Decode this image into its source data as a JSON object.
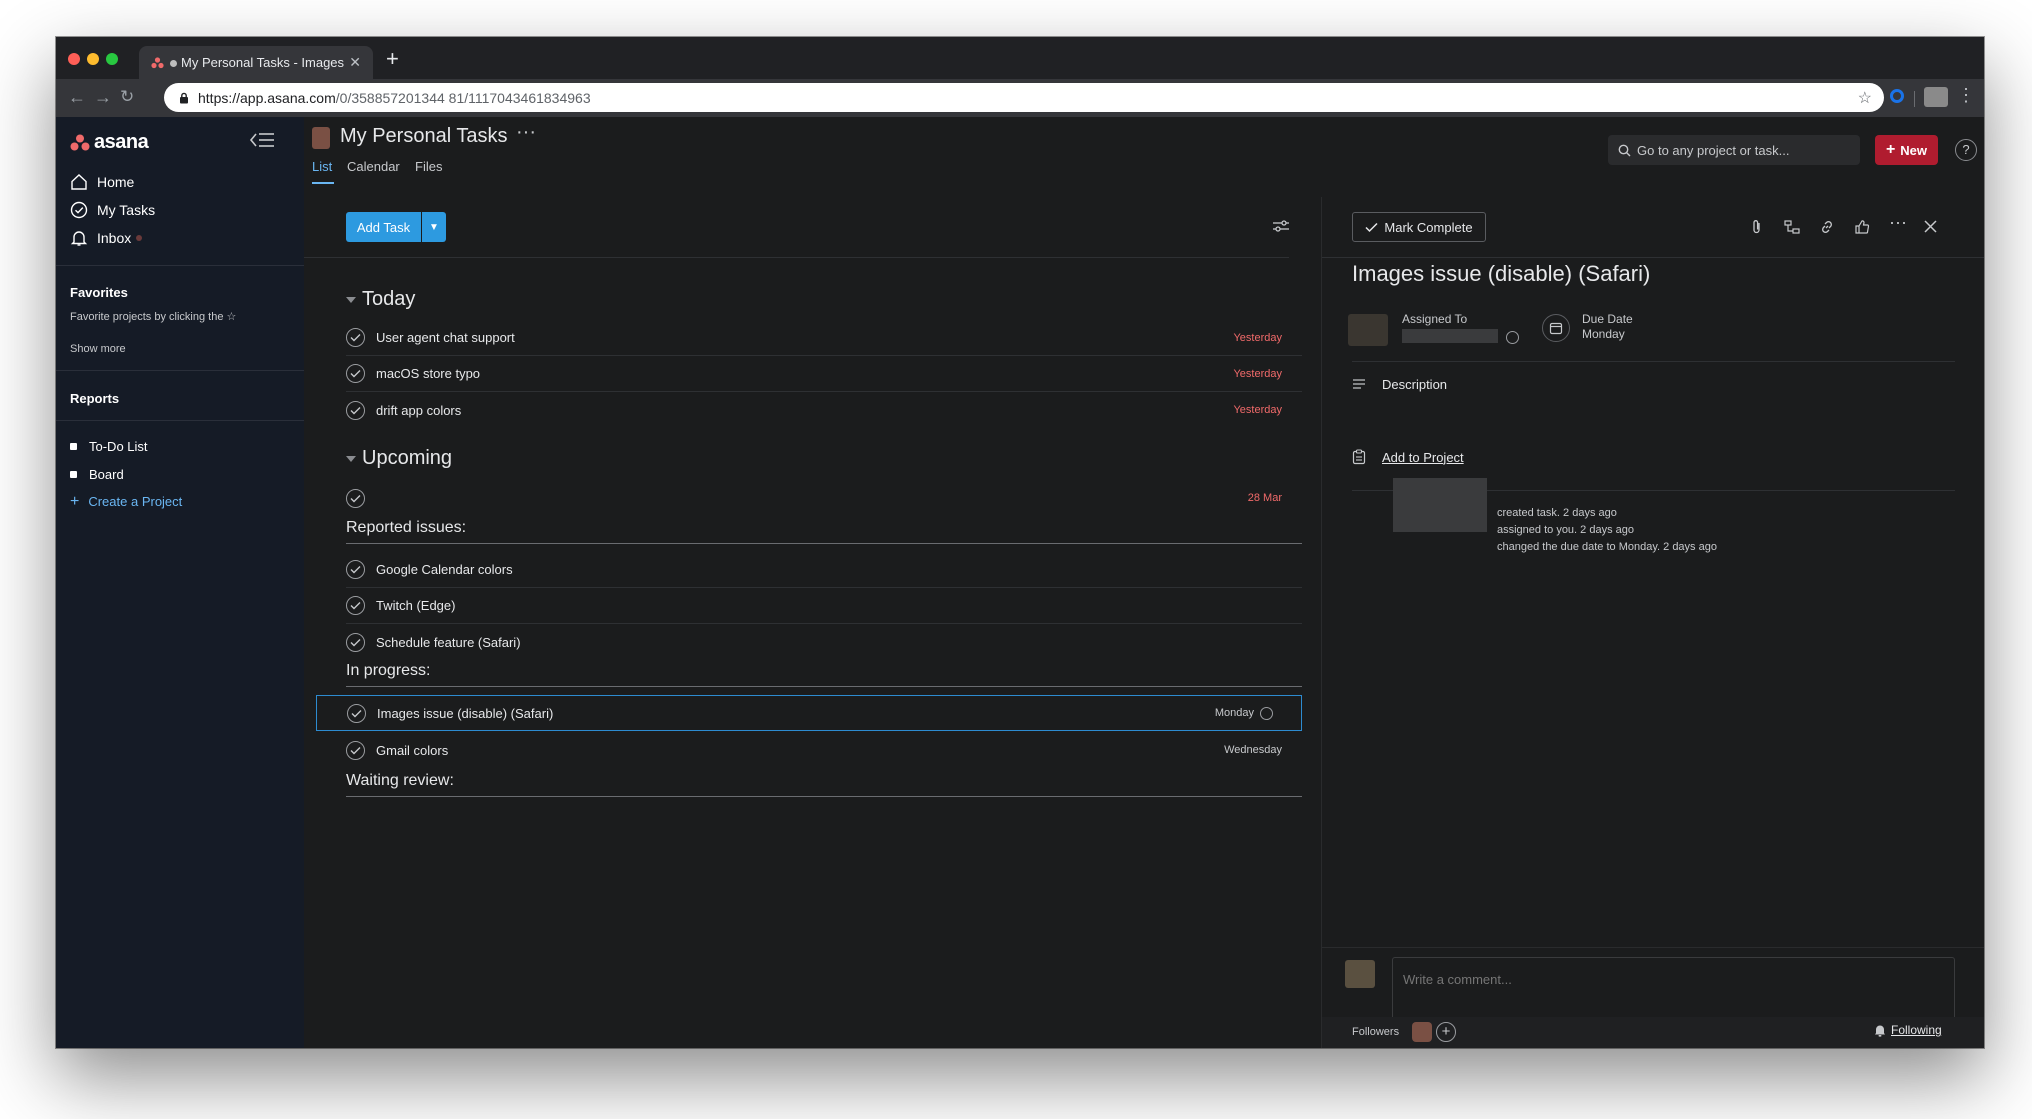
{
  "browser": {
    "tab_title": "My Personal Tasks - Images",
    "url_domain": "https://app.asana.com",
    "url_path": "/0/358857201344 81/1117043461834963"
  },
  "sidebar": {
    "logo": "asana",
    "nav": [
      {
        "label": "Home",
        "icon": "home-icon"
      },
      {
        "label": "My Tasks",
        "icon": "check-circle-icon"
      },
      {
        "label": "Inbox",
        "icon": "bell-icon"
      }
    ],
    "favorites_heading": "Favorites",
    "favorites_hint": "Favorite projects by clicking the ☆",
    "show_more": "Show more",
    "reports_heading": "Reports",
    "projects": [
      {
        "label": "To-Do List"
      },
      {
        "label": "Board"
      }
    ],
    "create_project": "Create a Project"
  },
  "header": {
    "project_title": "My Personal Tasks",
    "more": "···",
    "tabs": [
      {
        "label": "List",
        "active": true
      },
      {
        "label": "Calendar",
        "active": false
      },
      {
        "label": "Files",
        "active": false
      }
    ],
    "search_placeholder": "Go to any project or task...",
    "new_button": "New",
    "help": "?"
  },
  "list": {
    "add_task": "Add Task",
    "sections": {
      "today": "Today",
      "upcoming": "Upcoming",
      "reported": "Reported issues:",
      "in_progress": "In progress:",
      "waiting": "Waiting review:"
    },
    "today_tasks": [
      {
        "name": "User agent chat support",
        "due": "Yesterday"
      },
      {
        "name": "macOS store typo",
        "due": "Yesterday"
      },
      {
        "name": "drift app colors",
        "due": "Yesterday"
      }
    ],
    "upcoming_tasks": [
      {
        "name": "",
        "due": "28 Mar"
      }
    ],
    "reported_tasks": [
      {
        "name": "Google Calendar colors",
        "due": ""
      },
      {
        "name": "Twitch (Edge)",
        "due": ""
      },
      {
        "name": "Schedule feature (Safari)",
        "due": ""
      }
    ],
    "in_progress_tasks": [
      {
        "name": "Images issue (disable) (Safari)",
        "due": "Monday"
      },
      {
        "name": "Gmail colors",
        "due": "Wednesday"
      }
    ]
  },
  "detail": {
    "mark_complete": "Mark Complete",
    "title": "Images issue (disable) (Safari)",
    "assigned_to_label": "Assigned To",
    "due_date_label": "Due Date",
    "due_date_value": "Monday",
    "description_label": "Description",
    "add_to_project": "Add to Project",
    "activity": [
      "created task.   2 days ago",
      "assigned to you.   2 days ago",
      "changed the due date to Monday.   2 days ago"
    ],
    "comment_placeholder": "Write a comment...",
    "followers_label": "Followers",
    "following_label": "Following"
  },
  "colors": {
    "accent_blue": "#2d9ae0",
    "new_red": "#b01c2f",
    "due_red": "#f06a6a",
    "sidebar_bg": "#151b26",
    "main_bg": "#1b1c1d"
  }
}
